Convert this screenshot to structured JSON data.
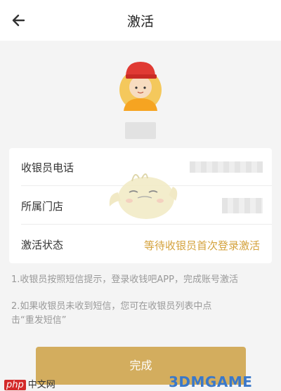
{
  "header": {
    "title": "激活"
  },
  "card": {
    "rows": [
      {
        "label": "收银员电话"
      },
      {
        "label": "所属门店"
      },
      {
        "label": "激活状态",
        "value": "等待收银员首次登录激活"
      }
    ]
  },
  "notes": {
    "line1": "1.收银员按照短信提示，登录收钱吧APP，完成账号激活",
    "line2": "2.如果收银员未收到短信，您可在收银员列表中点击“重发短信”"
  },
  "button": {
    "label": "完成"
  },
  "watermarks": {
    "php_tag": "php",
    "php_text": "中文网",
    "game": "3DMGAME"
  },
  "colors": {
    "accent": "#d4a23c",
    "button": "#d3ad5e"
  }
}
